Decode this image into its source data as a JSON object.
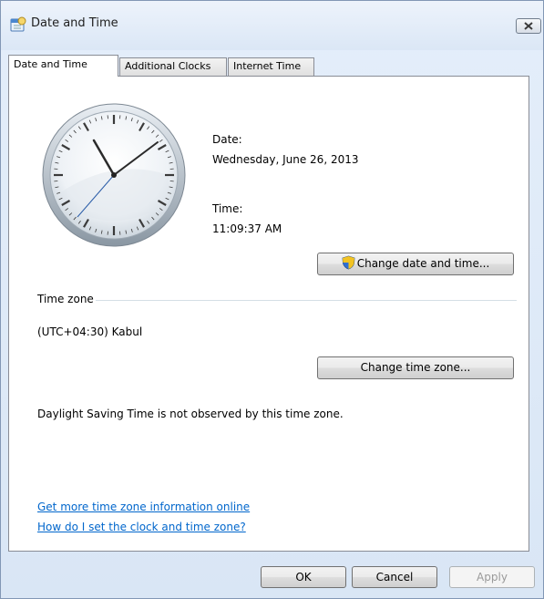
{
  "window": {
    "title": "Date and Time"
  },
  "tabs": [
    {
      "label": "Date and Time"
    },
    {
      "label": "Additional Clocks"
    },
    {
      "label": "Internet Time"
    }
  ],
  "datetime": {
    "date_label": "Date:",
    "date_value": "Wednesday, June 26, 2013",
    "time_label": "Time:",
    "time_value": "11:09:37 AM",
    "change_button": "Change date and time..."
  },
  "timezone": {
    "group_label": "Time zone",
    "value": "(UTC+04:30) Kabul",
    "change_button": "Change time zone...",
    "dst_note": "Daylight Saving Time is not observed by this time zone."
  },
  "links": {
    "more_info": "Get more time zone information online",
    "how_to": "How do I set the clock and time zone?"
  },
  "buttons": {
    "ok": "OK",
    "cancel": "Cancel",
    "apply": "Apply"
  },
  "icons": {
    "title": "calendar-clock-icon",
    "close": "close-icon",
    "shield": "uac-shield-icon"
  }
}
